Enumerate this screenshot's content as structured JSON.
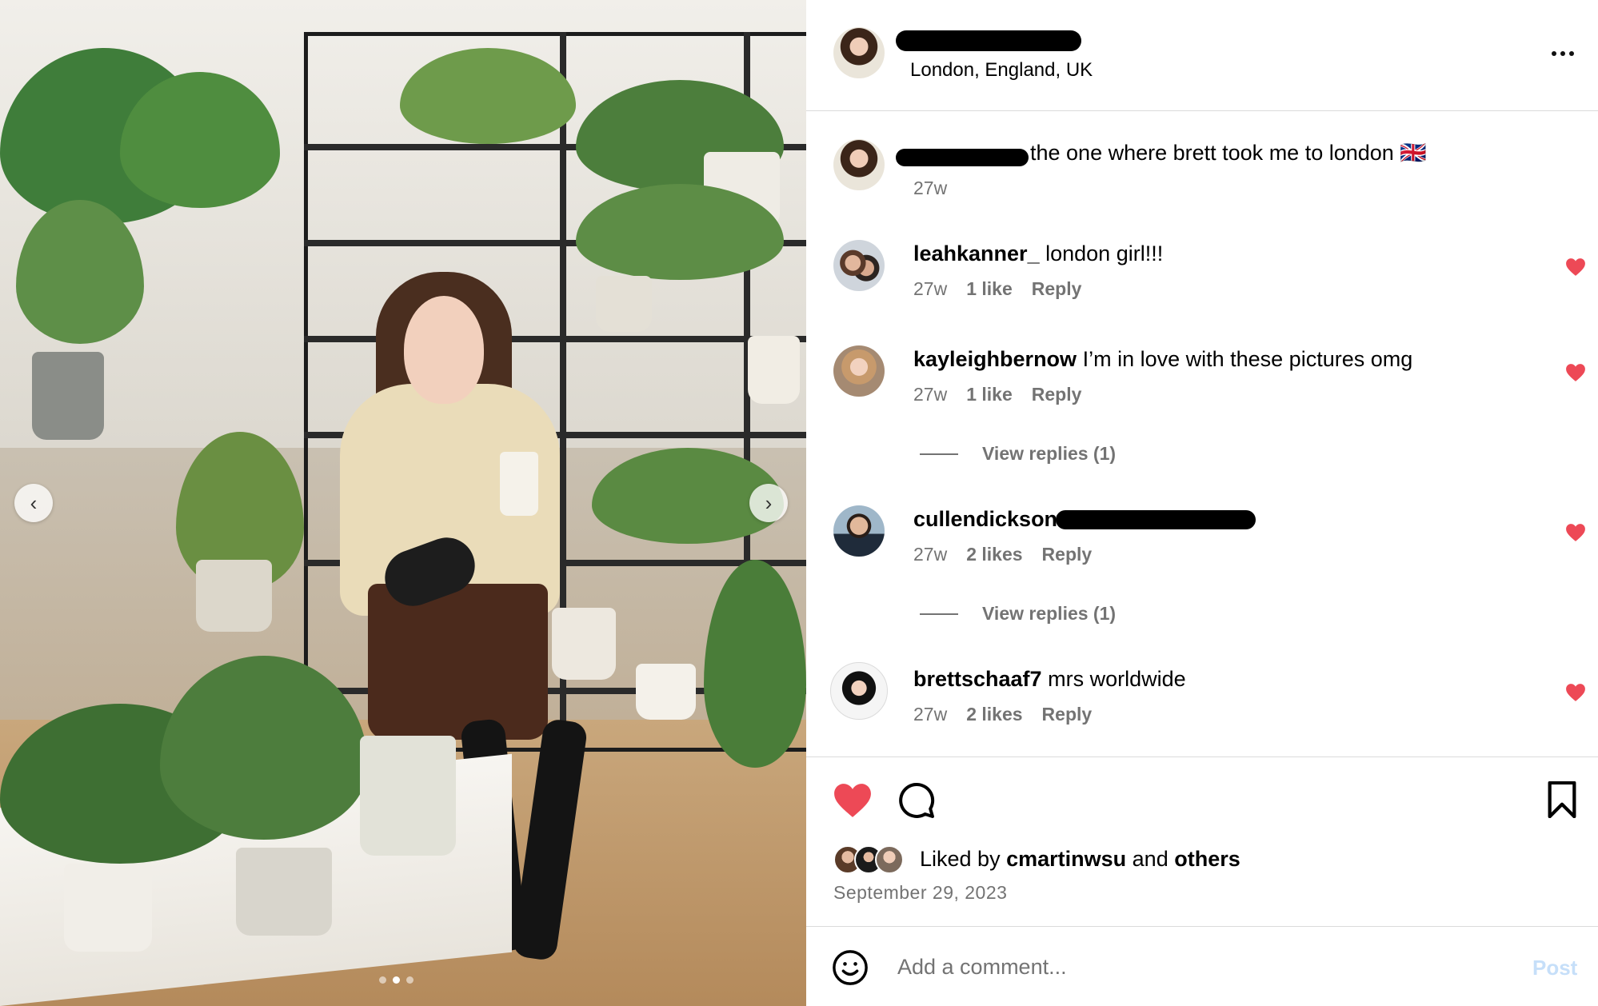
{
  "post": {
    "location": "London, England, UK",
    "caption": {
      "text": "the one where brett took me to london 🇬🇧",
      "time": "27w"
    }
  },
  "comments": [
    {
      "username": "leahkanner_",
      "text": "london girl!!!",
      "time": "27w",
      "likes": "1 like",
      "reply_label": "Reply",
      "liked": true
    },
    {
      "username": "kayleighbernow",
      "text": "I’m in love with these pictures omg",
      "time": "27w",
      "likes": "1 like",
      "reply_label": "Reply",
      "liked": true,
      "view_replies": "View replies (1)"
    },
    {
      "username": "cullendickson",
      "text": "",
      "time": "27w",
      "likes": "2 likes",
      "reply_label": "Reply",
      "liked": true,
      "view_replies": "View replies (1)"
    },
    {
      "username": "brettschaaf7",
      "text": "mrs worldwide",
      "time": "27w",
      "likes": "2 likes",
      "reply_label": "Reply",
      "liked": true
    }
  ],
  "actions": {
    "liked_by_prefix": "Liked by",
    "liked_by_user": "cmartinwsu",
    "liked_by_and": "and",
    "liked_by_others": "others",
    "date": "September 29, 2023"
  },
  "add_comment": {
    "placeholder": "Add a comment...",
    "post_label": "Post"
  },
  "carousel": {
    "prev_glyph": "‹",
    "next_glyph": "›",
    "total_slides": 3,
    "active_slide": 2
  },
  "colors": {
    "heart_red": "#ed4956",
    "secondary_text": "#737373",
    "divider": "#dbdbdb",
    "post_button_disabled": "#c6dff9"
  },
  "icons": {
    "like": "heart-icon",
    "comment": "comment-bubble-icon",
    "save": "bookmark-icon",
    "emoji": "emoji-smile-icon",
    "more": "more-options-icon"
  }
}
